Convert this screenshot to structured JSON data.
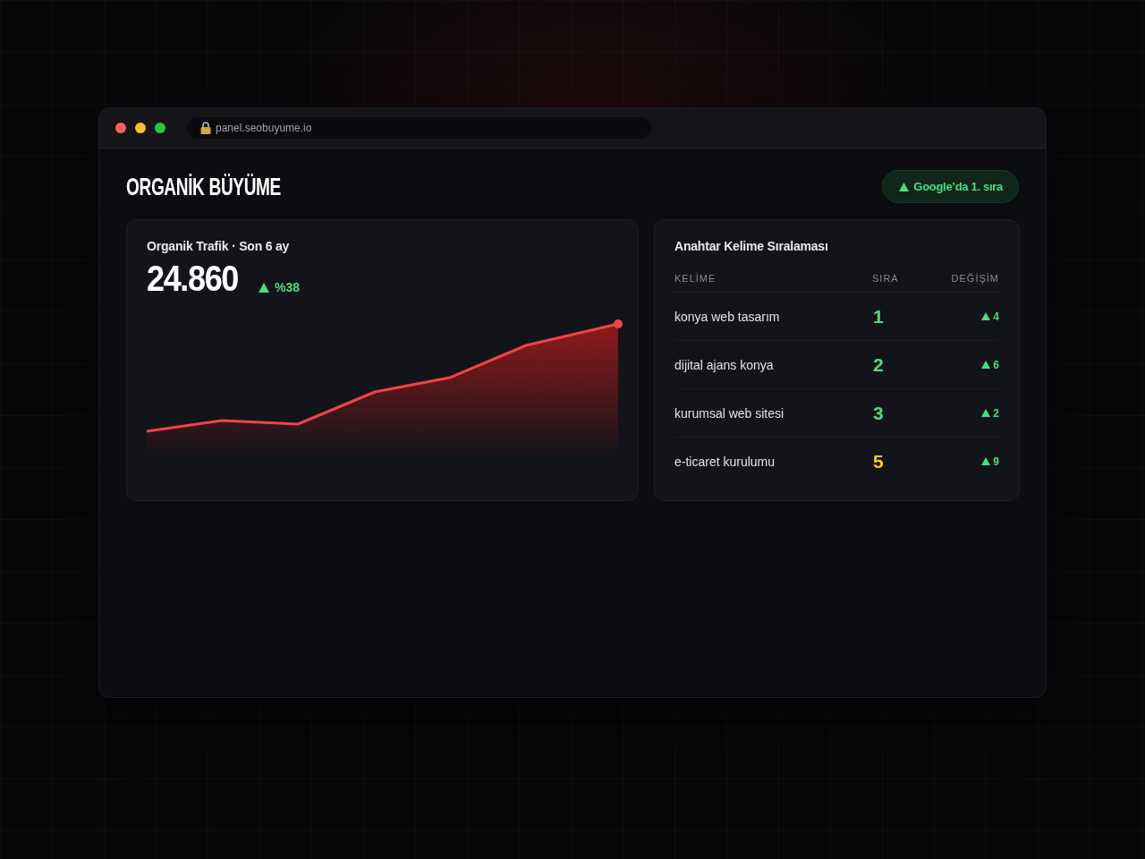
{
  "window": {
    "buttons": [
      {
        "color": "#ff5f57"
      },
      {
        "color": "#febc2e"
      },
      {
        "color": "#28c840"
      }
    ],
    "url": "panel.seobuyume.io"
  },
  "header": {
    "title": "ORGANİK BÜYÜME",
    "badge": "Google’da 1. sıra"
  },
  "traffic_card": {
    "title": "Organik Trafik · Son 6 ay",
    "value": "24.860",
    "change": "%38"
  },
  "keywords_card": {
    "title": "Anahtar Kelime Sıralaması",
    "columns": [
      "KELİME",
      "SIRA",
      "DEĞİŞİM"
    ],
    "rows": [
      {
        "keyword": "konya web tasarım",
        "rank": "1",
        "color": "#4ade80",
        "change": "4"
      },
      {
        "keyword": "dijital ajans konya",
        "rank": "2",
        "color": "#4ade80",
        "change": "6"
      },
      {
        "keyword": "kurumsal web sitesi",
        "rank": "3",
        "color": "#4ade80",
        "change": "2"
      },
      {
        "keyword": "e-ticaret kurulumu",
        "rank": "5",
        "color": "#facc15",
        "change": "9"
      }
    ]
  }
}
